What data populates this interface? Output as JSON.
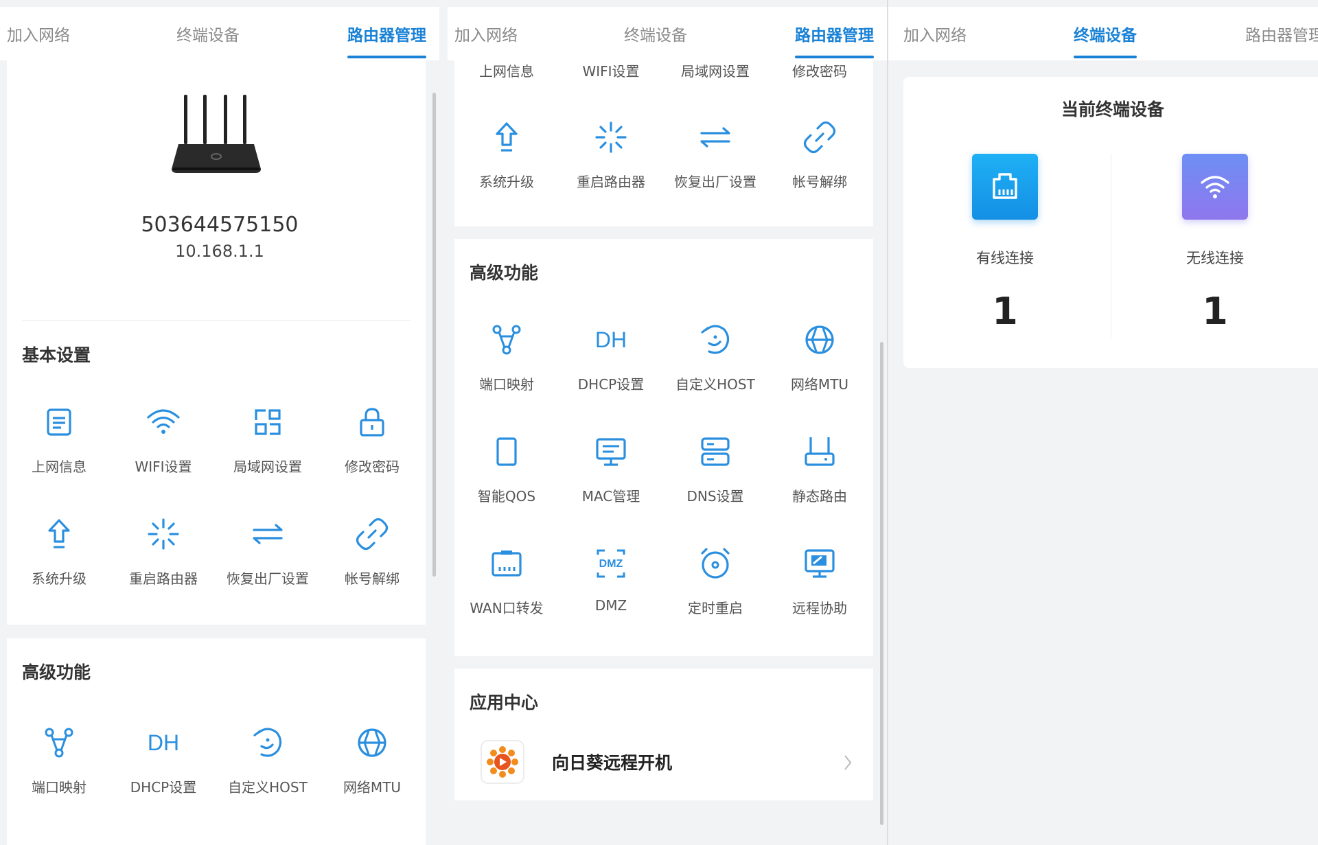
{
  "tabs": {
    "join": "加入网络",
    "devices": "终端设备",
    "router": "路由器管理"
  },
  "router": {
    "id": "503644575150",
    "ip": "10.168.1.1"
  },
  "basic": {
    "title": "基本设置",
    "items": [
      "上网信息",
      "WIFI设置",
      "局域网设置",
      "修改密码",
      "系统升级",
      "重启路由器",
      "恢复出厂设置",
      "帐号解绑"
    ]
  },
  "advanced": {
    "title": "高级功能",
    "items": [
      "端口映射",
      "DHCP设置",
      "自定义HOST",
      "网络MTU",
      "智能QOS",
      "MAC管理",
      "DNS设置",
      "静态路由",
      "WAN口转发",
      "DMZ",
      "定时重启",
      "远程协助"
    ],
    "dh_glyph": "DH",
    "dmz_glyph": "DMZ"
  },
  "apps": {
    "title": "应用中心",
    "item": "向日葵远程开机"
  },
  "devices": {
    "title": "当前终端设备",
    "wired_label": "有线连接",
    "wired_count": "1",
    "wireless_label": "无线连接",
    "wireless_count": "1"
  },
  "colors": {
    "accent": "#1a82d6",
    "icon": "#2a8fdf",
    "wired_tile": "#1da5ef",
    "wireless_tile": "#7b7ef0",
    "app_orange": "#f28c1c"
  }
}
